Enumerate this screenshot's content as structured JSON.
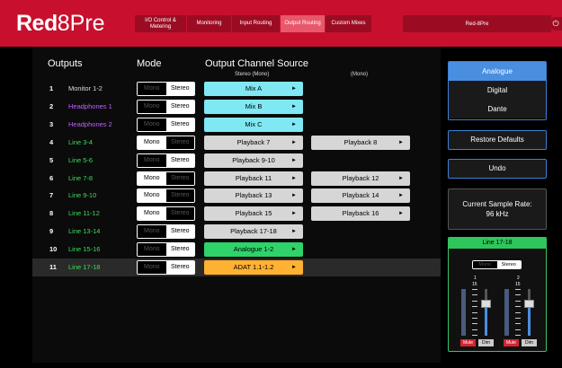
{
  "app": {
    "logo_bold": "Red",
    "logo_thin": "8Pre",
    "device_name": "Red-8Pre",
    "power_glyph": "⏻"
  },
  "nav": {
    "active_index": 3,
    "tabs": [
      {
        "label": "I/O Control & Metering"
      },
      {
        "label": "Monitoring"
      },
      {
        "label": "Input Routing"
      },
      {
        "label": "Output Routing"
      },
      {
        "label": "Custom Mixes"
      }
    ]
  },
  "headers": {
    "outputs": "Outputs",
    "mode": "Mode",
    "source": "Output Channel Source",
    "stereo_mono": "Stereo (Mono)",
    "mono": "(Mono)"
  },
  "mode_labels": {
    "mono": "Mono",
    "stereo": "Stereo"
  },
  "arrow_glyph": "►",
  "colors": {
    "brand_red": "#c8102e",
    "name_white": "#dddddd",
    "name_purple": "#c060ff",
    "name_green": "#3ddc5a",
    "src_cyan": "#7fe8f2",
    "src_grey": "#d6d6d6",
    "src_green": "#2ed36a",
    "src_orange": "#ffb132",
    "accent_blue": "#4a8ee0"
  },
  "outputs": [
    {
      "num": "1",
      "name": "Monitor 1-2",
      "name_color": "white",
      "mode": "stereo",
      "src1": "Mix A",
      "src1_color": "cyan",
      "src2": ""
    },
    {
      "num": "2",
      "name": "Headphones 1",
      "name_color": "purple",
      "mode": "stereo",
      "src1": "Mix B",
      "src1_color": "cyan",
      "src2": ""
    },
    {
      "num": "3",
      "name": "Headphones 2",
      "name_color": "purple",
      "mode": "stereo",
      "src1": "Mix C",
      "src1_color": "cyan",
      "src2": ""
    },
    {
      "num": "4",
      "name": "Line 3-4",
      "name_color": "green",
      "mode": "mono",
      "src1": "Playback 7",
      "src1_color": "grey",
      "src2": "Playback 8"
    },
    {
      "num": "5",
      "name": "Line 5-6",
      "name_color": "green",
      "mode": "stereo",
      "src1": "Playback 9-10",
      "src1_color": "grey",
      "src2": ""
    },
    {
      "num": "6",
      "name": "Line 7-8",
      "name_color": "green",
      "mode": "mono",
      "src1": "Playback 11",
      "src1_color": "grey",
      "src2": "Playback 12"
    },
    {
      "num": "7",
      "name": "Line 9-10",
      "name_color": "green",
      "mode": "mono",
      "src1": "Playback 13",
      "src1_color": "grey",
      "src2": "Playback 14"
    },
    {
      "num": "8",
      "name": "Line 11-12",
      "name_color": "green",
      "mode": "mono",
      "src1": "Playback 15",
      "src1_color": "grey",
      "src2": "Playback 16"
    },
    {
      "num": "9",
      "name": "Line 13-14",
      "name_color": "green",
      "mode": "stereo",
      "src1": "Playback 17-18",
      "src1_color": "grey",
      "src2": ""
    },
    {
      "num": "10",
      "name": "Line 15-16",
      "name_color": "green",
      "mode": "stereo",
      "src1": "Analogue 1-2",
      "src1_color": "green",
      "src2": ""
    },
    {
      "num": "11",
      "name": "Line 17-18",
      "name_color": "green",
      "mode": "stereo",
      "src1": "ADAT 1.1-1.2",
      "src1_color": "orange",
      "src2": "",
      "selected": true
    }
  ],
  "digital_io": {
    "selected_index": 0,
    "options": [
      "Analogue",
      "Digital",
      "Dante"
    ]
  },
  "buttons": {
    "restore": "Restore Defaults",
    "undo": "Undo"
  },
  "sample_rate": {
    "label": "Current Sample Rate:",
    "value": "96 kHz"
  },
  "monitor": {
    "title": "Line 17-18",
    "mode": "stereo",
    "channels": [
      {
        "label": "1",
        "scale_top": "15",
        "fader_level": 0.7,
        "mute_label": "Mute",
        "dim_label": "Dim"
      },
      {
        "label": "2",
        "scale_top": "15",
        "fader_level": 0.7,
        "mute_label": "Mute",
        "dim_label": "Dim"
      }
    ]
  }
}
